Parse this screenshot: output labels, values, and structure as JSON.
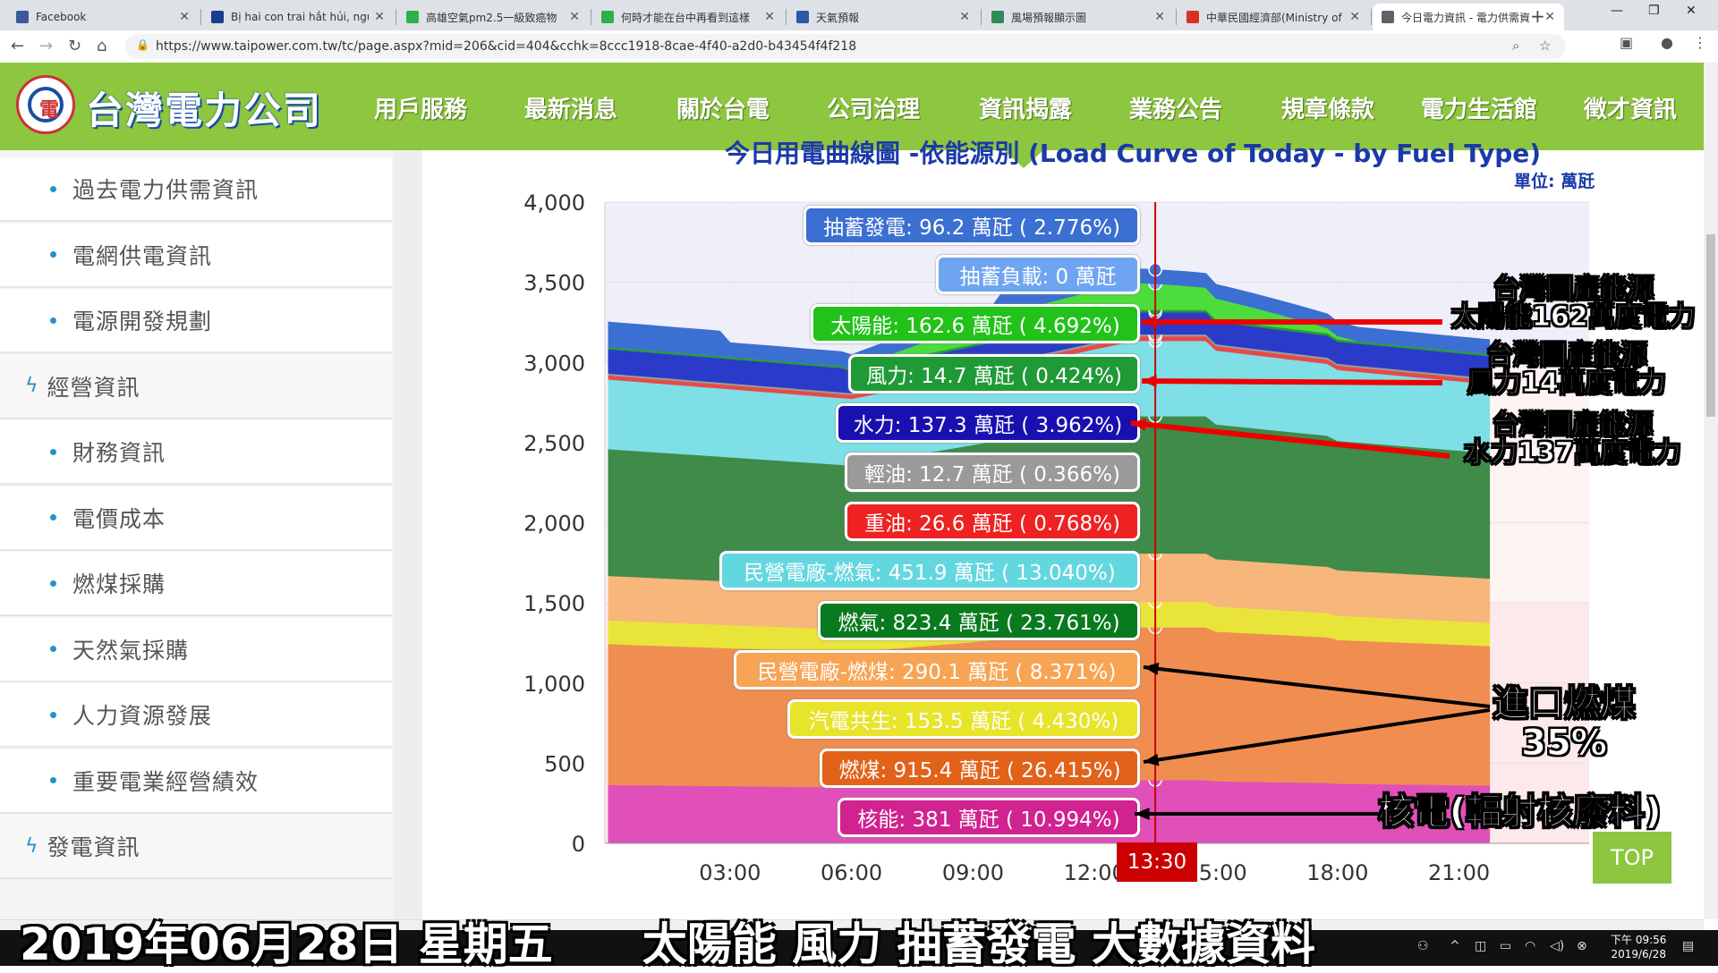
{
  "browser": {
    "tabs": [
      {
        "title": "Facebook",
        "color": "#3b5998"
      },
      {
        "title": "Bị hai con trai hắt hủi, ngườ",
        "color": "#1a3d8f"
      },
      {
        "title": "高雄空氣pm2.5一級致癌物",
        "color": "#2bb24c"
      },
      {
        "title": "何時才能在台中再看到這樣",
        "color": "#2bb24c"
      },
      {
        "title": "天氣預報",
        "color": "#2b58a8"
      },
      {
        "title": "風場預報顯示圖",
        "color": "#2e8b57"
      },
      {
        "title": "中華民國經濟部(Ministry of",
        "color": "#d93025"
      },
      {
        "title": "今日電力資訊 - 電力供需資",
        "color": "#5f6368"
      }
    ],
    "url": "https://www.taipower.com.tw/tc/page.aspx?mid=206&cid=404&cchk=8ccc1918-8cae-4f40-a2d0-b43454f4f218"
  },
  "site": {
    "logo_text": "台灣電力公司",
    "nav": [
      "用戶服務",
      "最新消息",
      "關於台電",
      "公司治理",
      "資訊揭露",
      "業務公告",
      "規章條款",
      "電力生活館",
      "徵才資訊"
    ]
  },
  "sidebar": [
    {
      "label": "過去電力供需資訊",
      "type": "sub"
    },
    {
      "label": "電網供電資訊",
      "type": "sub"
    },
    {
      "label": "電源開發規劃",
      "type": "sub"
    },
    {
      "label": "經營資訊",
      "type": "cat"
    },
    {
      "label": "財務資訊",
      "type": "sub"
    },
    {
      "label": "電價成本",
      "type": "sub"
    },
    {
      "label": "燃煤採購",
      "type": "sub"
    },
    {
      "label": "天然氣採購",
      "type": "sub"
    },
    {
      "label": "人力資源發展",
      "type": "sub"
    },
    {
      "label": "重要電業經營績效",
      "type": "sub"
    },
    {
      "label": "發電資訊",
      "type": "cat"
    }
  ],
  "chart_data": {
    "type": "area",
    "title": "今日用電曲線圖 -依能源別 (Load Curve of Today - by Fuel Type)",
    "unit": "單位: 萬瓩",
    "ylim": [
      0,
      4000
    ],
    "yticks": [
      "0",
      "500",
      "1,000",
      "1,500",
      "2,000",
      "2,500",
      "3,000",
      "3,500",
      "4,000"
    ],
    "xticks": [
      "03:00",
      "06:00",
      "09:00",
      "12:00",
      "15:00",
      "18:00",
      "21:00"
    ],
    "cursor_time": "13:30",
    "series": [
      {
        "name": "核能",
        "value": 381,
        "pct": "10.994%",
        "color": "#e050b8"
      },
      {
        "name": "燃煤",
        "value": 915.4,
        "pct": "26.415%",
        "color": "#ef8e50"
      },
      {
        "name": "汽電共生",
        "value": 153.5,
        "pct": "4.430%",
        "color": "#e9e43a"
      },
      {
        "name": "民營電廠-燃煤",
        "value": 290.1,
        "pct": "8.371%",
        "color": "#f7b67a"
      },
      {
        "name": "燃氣",
        "value": 823.4,
        "pct": "23.761%",
        "color": "#3e8b4a"
      },
      {
        "name": "民營電廠-燃氣",
        "value": 451.9,
        "pct": "13.040%",
        "color": "#7fdfe6"
      },
      {
        "name": "重油",
        "value": 26.6,
        "pct": "0.768%",
        "color": "#e94848"
      },
      {
        "name": "輕油",
        "value": 12.7,
        "pct": "0.366%",
        "color": "#9a9a9a"
      },
      {
        "name": "水力",
        "value": 137.3,
        "pct": "3.962%",
        "color": "#2a3bc9"
      },
      {
        "name": "風力",
        "value": 14.7,
        "pct": "0.424%",
        "color": "#2a9a3a"
      },
      {
        "name": "太陽能",
        "value": 162.6,
        "pct": "4.692%",
        "color": "#4cdc3c"
      },
      {
        "name": "抽蓄負載",
        "value": 0,
        "pct": "",
        "color": "#6fa5f0"
      },
      {
        "name": "抽蓄發電",
        "value": 96.2,
        "pct": "2.776%",
        "color": "#3b6fd1"
      }
    ],
    "tooltip_labels": [
      "抽蓄發電: 96.2 萬瓩 ( 2.776%)",
      "抽蓄負載: 0 萬瓩",
      "太陽能: 162.6 萬瓩 ( 4.692%)",
      "風力: 14.7 萬瓩 ( 0.424%)",
      "水力: 137.3 萬瓩 ( 3.962%)",
      "輕油: 12.7 萬瓩 ( 0.366%)",
      "重油: 26.6 萬瓩 ( 0.768%)",
      "民營電廠-燃氣: 451.9 萬瓩 ( 13.040%)",
      "燃氣: 823.4 萬瓩 ( 23.761%)",
      "民營電廠-燃煤: 290.1 萬瓩 ( 8.371%)",
      "汽電共生: 153.5 萬瓩 ( 4.430%)",
      "燃煤: 915.4 萬瓩 ( 26.415%)",
      "核能: 381 萬瓩 ( 10.994%)"
    ]
  },
  "annotations": {
    "solar": [
      "台灣國產能源",
      "太陽能162萬度電力"
    ],
    "wind": [
      "台灣國產能源",
      "風力14萬度電力"
    ],
    "hydro": [
      "台灣國產能源",
      "水力137萬度電力"
    ],
    "coal": [
      "進口燃煤",
      "35%"
    ],
    "nuclear": "核電(輻射核廢料)"
  },
  "top_button": "TOP",
  "subtitle": "2019年06月28日 星期五　　太陽能  風力 抽蓄發電 大數據資料",
  "clock": {
    "time": "下午 09:56",
    "date": "2019/6/28"
  }
}
